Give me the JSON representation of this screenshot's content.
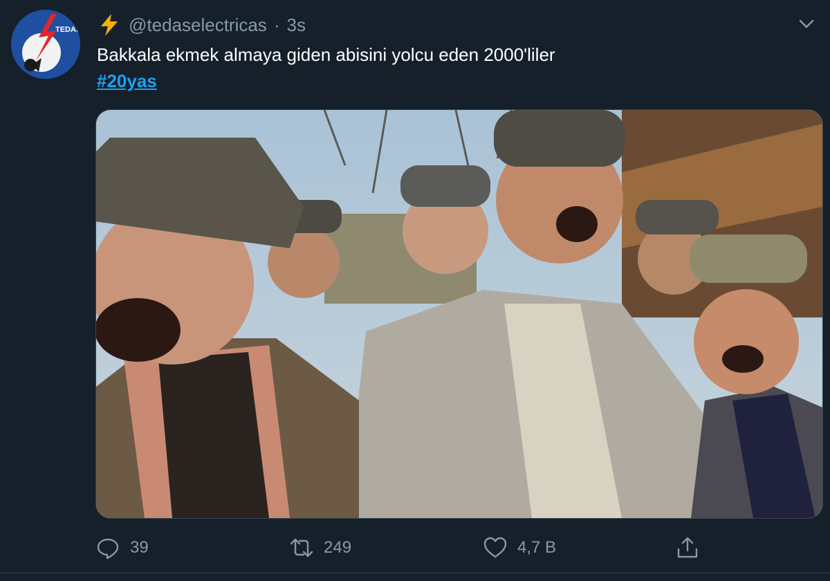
{
  "tweet": {
    "handle": "@tedaselectricas",
    "separator": "·",
    "time": "3s",
    "text": "Bakkala ekmek almaya giden abisini yolcu eden 2000'liler",
    "hashtag": "#20yas",
    "avatar_label": "TEDAŞ",
    "icons": {
      "name_emoji": "lightning-icon",
      "menu": "chevron-down-icon",
      "reply": "reply-icon",
      "retweet": "retweet-icon",
      "like": "heart-icon",
      "share": "share-icon"
    }
  },
  "stats": {
    "replies": "39",
    "retweets": "249",
    "likes": "4,7 B"
  },
  "colors": {
    "background": "#15202b",
    "text": "#ffffff",
    "secondary_text": "#8899a6",
    "link": "#1da1f2",
    "bolt": "#f5b301",
    "avatar": "#1f4fa0"
  }
}
